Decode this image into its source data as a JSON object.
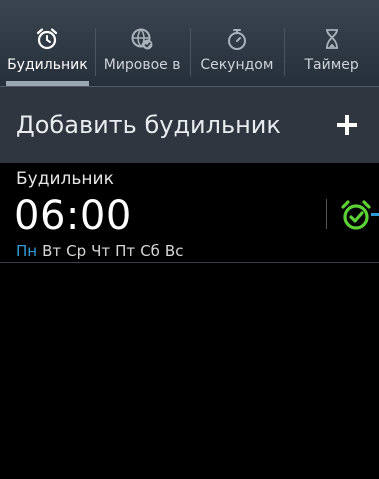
{
  "tabs": [
    {
      "label": "Будильник",
      "icon": "alarm-clock-icon",
      "active": true
    },
    {
      "label": "Мировое в",
      "icon": "globe-icon",
      "active": false
    },
    {
      "label": "Секундом",
      "icon": "stopwatch-icon",
      "active": false
    },
    {
      "label": "Таймер",
      "icon": "hourglass-icon",
      "active": false
    }
  ],
  "add_row": {
    "label": "Добавить будильник",
    "icon": "plus-icon"
  },
  "alarm": {
    "name": "Будильник",
    "time": "06:00",
    "days": [
      {
        "label": "Пн",
        "active": true
      },
      {
        "label": "Вт",
        "active": false
      },
      {
        "label": "Ср",
        "active": false
      },
      {
        "label": "Чт",
        "active": false
      },
      {
        "label": "Пт",
        "active": false
      },
      {
        "label": "Сб",
        "active": false
      },
      {
        "label": "Вс",
        "active": false
      }
    ],
    "enabled": true,
    "toggle_icon": "alarm-on-icon"
  },
  "colors": {
    "accent": "#2f9bd6",
    "alarm_on": "#5bd136",
    "tab_bg": "#2f3943",
    "add_row_bg": "#2f3640"
  }
}
